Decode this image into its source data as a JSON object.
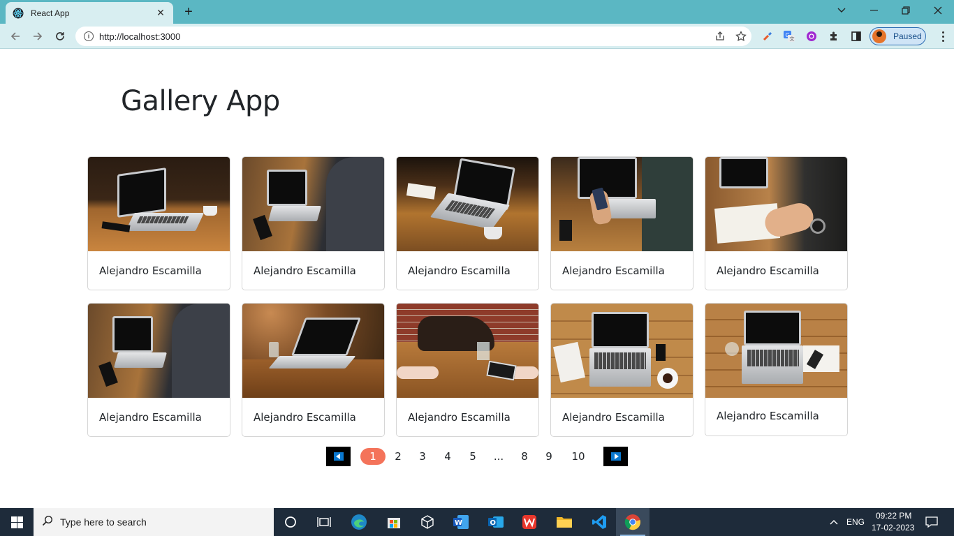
{
  "browser": {
    "tab_title": "React App",
    "url": "http://localhost:3000",
    "profile_label": "Paused"
  },
  "page": {
    "title": "Gallery App"
  },
  "gallery": {
    "cards": [
      {
        "author": "Alejandro Escamilla",
        "icon": "laptop-on-table-photo"
      },
      {
        "author": "Alejandro Escamilla",
        "icon": "man-typing-laptop-photo"
      },
      {
        "author": "Alejandro Escamilla",
        "icon": "laptop-coffee-photo"
      },
      {
        "author": "Alejandro Escamilla",
        "icon": "man-holding-phone-photo"
      },
      {
        "author": "Alejandro Escamilla",
        "icon": "man-writing-notebook-photo"
      },
      {
        "author": "Alejandro Escamilla",
        "icon": "man-typing-laptop-photo"
      },
      {
        "author": "Alejandro Escamilla",
        "icon": "laptop-side-view-photo"
      },
      {
        "author": "Alejandro Escamilla",
        "icon": "people-table-bag-photo"
      },
      {
        "author": "Alejandro Escamilla",
        "icon": "laptop-topdown-photo"
      },
      {
        "author": "Alejandro Escamilla",
        "icon": "laptop-topdown-photo"
      }
    ]
  },
  "pagination": {
    "pages": [
      "1",
      "2",
      "3",
      "4",
      "5",
      "...",
      "8",
      "9",
      "10"
    ],
    "current": "1",
    "prev_icon": "triangle-left-icon",
    "next_icon": "triangle-right-icon"
  },
  "taskbar": {
    "search_placeholder": "Type here to search",
    "language": "ENG",
    "time": "09:22 PM",
    "date": "17-02-2023"
  },
  "colors": {
    "tabbar": "#5bb7c3",
    "toolbar": "#d8eef1",
    "active_page": "#f4735a",
    "arrow_fill": "#0a78d0",
    "taskbar": "#1e2b3a"
  }
}
